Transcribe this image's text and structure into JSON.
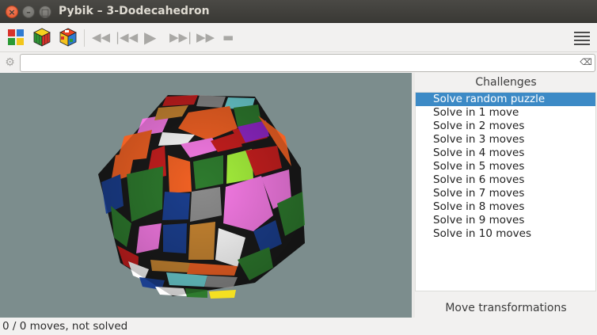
{
  "window": {
    "title": "Pybik – 3-Dodecahedron",
    "close_glyph": "×",
    "min_glyph": "–",
    "max_glyph": "□"
  },
  "toolbar": {
    "buttons": [
      {
        "name": "new-game-icon"
      },
      {
        "name": "new-solved-icon"
      },
      {
        "name": "new-random-icon"
      }
    ],
    "media": {
      "rewind": "◀◀",
      "previous": "|◀◀",
      "play": "▶",
      "next": "▶▶|",
      "forward": "▶▶",
      "stop": "▬"
    }
  },
  "edit": {
    "value": "",
    "placeholder": "",
    "clear_glyph": "⌫"
  },
  "right_panel": {
    "header": "Challenges",
    "items": [
      "Solve random puzzle",
      "Solve in 1 move",
      "Solve in 2 moves",
      "Solve in 3 moves",
      "Solve in 4 moves",
      "Solve in 5 moves",
      "Solve in 6 moves",
      "Solve in 7 moves",
      "Solve in 8 moves",
      "Solve in 9 moves",
      "Solve in 10 moves"
    ],
    "selected_index": 0,
    "footer": "Move transformations"
  },
  "status": {
    "text": "0 / 0 moves, not solved"
  },
  "colors": {
    "canvas_bg": "#7c8d8d",
    "selection": "#3c8ac6",
    "puzzle_faces": [
      "#f36224",
      "#f77be6",
      "#2e7b2e",
      "#1b3f8f",
      "#c91f1f",
      "#8b8b8b",
      "#c98632",
      "#a6f23c",
      "#9127c9",
      "#ffffff",
      "#6fd5d8",
      "#f4e021"
    ]
  }
}
